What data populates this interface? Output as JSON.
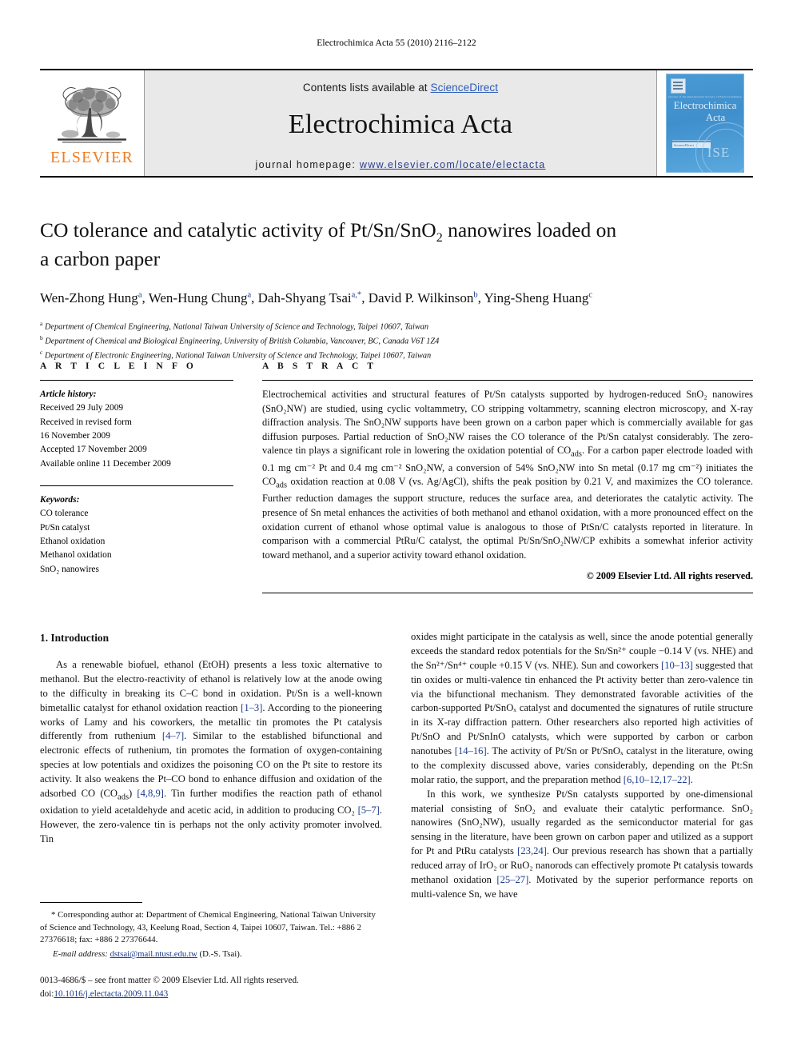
{
  "running_head": "Electrochimica Acta 55 (2010) 2116–2122",
  "masthead": {
    "publisher_name": "ELSEVIER",
    "contents_prefix": "Contents lists available at ",
    "contents_link": "ScienceDirect",
    "journal_name": "Electrochimica Acta",
    "homepage_prefix": "journal homepage: ",
    "homepage_url": "www.elsevier.com/locate/electacta",
    "cover": {
      "society_line": "Journal of the International Society of Electrochemistry",
      "title_line1": "Electrochimica",
      "title_line2": "Acta",
      "badge_text": "ScienceDirect",
      "emblem_text": "ISE"
    }
  },
  "title": "CO tolerance and catalytic activity of Pt/Sn/SnO₂ nanowires loaded on a carbon paper",
  "title_line1": "CO tolerance and catalytic activity of Pt/Sn/SnO",
  "title_line1_sub": "2",
  "title_line1_end": " nanowires loaded on",
  "title_line2": "a carbon paper",
  "authors": [
    {
      "name": "Wen-Zhong Hung",
      "sup": "a",
      "sep": ", "
    },
    {
      "name": "Wen-Hung Chung",
      "sup": "a",
      "sep": ", "
    },
    {
      "name": "Dah-Shyang Tsai",
      "sup": "a,*",
      "sep": ", "
    },
    {
      "name": "David P. Wilkinson",
      "sup": "b",
      "sep": ", "
    },
    {
      "name": "Ying-Sheng Huang",
      "sup": "c",
      "sep": ""
    }
  ],
  "affiliations": [
    {
      "sup": "a",
      "text": "Department of Chemical Engineering, National Taiwan University of Science and Technology, Taipei 10607, Taiwan"
    },
    {
      "sup": "b",
      "text": "Department of Chemical and Biological Engineering, University of British Columbia, Vancouver, BC, Canada V6T 1Z4"
    },
    {
      "sup": "c",
      "text": "Department of Electronic Engineering, National Taiwan University of Science and Technology, Taipei 10607, Taiwan"
    }
  ],
  "article_info": {
    "heading": "A R T I C L E  I N F O",
    "history_label": "Article history:",
    "history": [
      "Received 29 July 2009",
      "Received in revised form",
      "16 November 2009",
      "Accepted 17 November 2009",
      "Available online 11 December 2009"
    ],
    "keywords_label": "Keywords:",
    "keywords": [
      "CO tolerance",
      "Pt/Sn catalyst",
      "Ethanol oxidation",
      "Methanol oxidation",
      "SnO₂ nanowires"
    ]
  },
  "abstract": {
    "heading": "A B S T R A C T",
    "text": "Electrochemical activities and structural features of Pt/Sn catalysts supported by hydrogen-reduced SnO₂ nanowires (SnO₂NW) are studied, using cyclic voltammetry, CO stripping voltammetry, scanning electron microscopy, and X-ray diffraction analysis. The SnO₂NW supports have been grown on a carbon paper which is commercially available for gas diffusion purposes. Partial reduction of SnO₂NW raises the CO tolerance of the Pt/Sn catalyst considerably. The zero-valence tin plays a significant role in lowering the oxidation potential of CO_ads. For a carbon paper electrode loaded with 0.1 mg cm⁻² Pt and 0.4 mg cm⁻² SnO₂NW, a conversion of 54% SnO₂NW into Sn metal (0.17 mg cm⁻²) initiates the CO_ads oxidation reaction at 0.08 V (vs. Ag/AgCl), shifts the peak position by 0.21 V, and maximizes the CO tolerance. Further reduction damages the support structure, reduces the surface area, and deteriorates the catalytic activity. The presence of Sn metal enhances the activities of both methanol and ethanol oxidation, with a more pronounced effect on the oxidation current of ethanol whose optimal value is analogous to those of PtSn/C catalysts reported in literature. In comparison with a commercial PtRu/C catalyst, the optimal Pt/Sn/SnO₂NW/CP exhibits a somewhat inferior activity toward methanol, and a superior activity toward ethanol oxidation.",
    "copyright": "© 2009 Elsevier Ltd. All rights reserved."
  },
  "body": {
    "section_number_title": "1.  Introduction",
    "left_paragraph_1": "As a renewable biofuel, ethanol (EtOH) presents a less toxic alternative to methanol. But the electro-reactivity of ethanol is relatively low at the anode owing to the difficulty in breaking its C–C bond in oxidation. Pt/Sn is a well-known bimetallic catalyst for ethanol oxidation reaction [1–3]. According to the pioneering works of Lamy and his coworkers, the metallic tin promotes the Pt catalysis differently from ruthenium [4–7]. Similar to the established bifunctional and electronic effects of ruthenium, tin promotes the formation of oxygen-containing species at low potentials and oxidizes the poisoning CO on the Pt site to restore its activity. It also weakens the Pt–CO bond to enhance diffusion and oxidation of the adsorbed CO (CO_ads) [4,8,9]. Tin further modifies the reaction path of ethanol oxidation to yield acetaldehyde and acetic acid, in addition to producing CO₂ [5–7]. However, the zero-valence tin is perhaps not the only activity promoter involved. Tin",
    "right_paragraph_1": "oxides might participate in the catalysis as well, since the anode potential generally exceeds the standard redox potentials for the Sn/Sn²⁺ couple −0.14 V (vs. NHE) and the Sn²⁺/Sn⁴⁺ couple +0.15 V (vs. NHE). Sun and coworkers [10–13] suggested that tin oxides or multi-valence tin enhanced the Pt activity better than zero-valence tin via the bifunctional mechanism. They demonstrated favorable activities of the carbon-supported Pt/SnOₓ catalyst and documented the signatures of rutile structure in its X-ray diffraction pattern. Other researchers also reported high activities of Pt/SnO and Pt/SnInO catalysts, which were supported by carbon or carbon nanotubes [14–16]. The activity of Pt/Sn or Pt/SnOₓ catalyst in the literature, owing to the complexity discussed above, varies considerably, depending on the Pt:Sn molar ratio, the support, and the preparation method [6,10–12,17–22].",
    "right_paragraph_2": "In this work, we synthesize Pt/Sn catalysts supported by one-dimensional material consisting of SnO₂ and evaluate their catalytic performance. SnO₂ nanowires (SnO₂NW), usually regarded as the semiconductor material for gas sensing in the literature, have been grown on carbon paper and utilized as a support for Pt and PtRu catalysts [23,24]. Our previous research has shown that a partially reduced array of IrO₂ or RuO₂ nanorods can effectively promote Pt catalysis towards methanol oxidation [25–27]. Motivated by the superior performance reports on multi-valence Sn, we have"
  },
  "footnote": {
    "corresponding": "* Corresponding author at: Department of Chemical Engineering, National Taiwan University of Science and Technology, 43, Keelung Road, Section 4, Taipei 10607, Taiwan. Tel.: +886 2 27376618; fax: +886 2 27376644.",
    "email_label": "E-mail address:",
    "email": "dstsai@mail.ntust.edu.tw",
    "email_suffix": "(D.-S. Tsai)."
  },
  "imprint": {
    "issn_line": "0013-4686/$ – see front matter © 2009 Elsevier Ltd. All rights reserved.",
    "doi_label": "doi:",
    "doi": "10.1016/j.electacta.2009.11.043"
  },
  "colors": {
    "link_blue": "#1b3a8c",
    "sciencedirect_blue": "#2b5cb8",
    "elsevier_orange": "#F07C20",
    "cover_blue": "#4a9ad4",
    "masthead_gray": "#e9e9e9"
  }
}
